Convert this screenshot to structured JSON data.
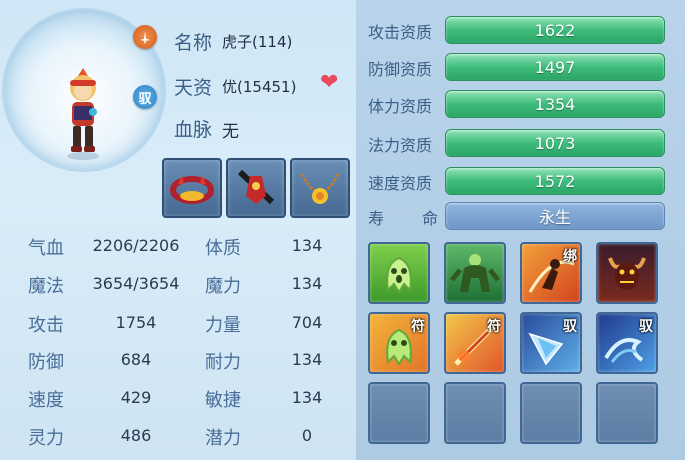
{
  "pet": {
    "name_label": "名称",
    "name_value": "虎子(114)",
    "aptitude_label": "天资",
    "aptitude_value": "优(15451)",
    "bloodline_label": "血脉",
    "bloodline_value": "无",
    "ride_badge": "驭"
  },
  "equipment": [
    {
      "name": "collar-equip"
    },
    {
      "name": "armor-equip"
    },
    {
      "name": "necklace-equip"
    }
  ],
  "stats": [
    {
      "label": "气血",
      "value": "2206/2206",
      "attr_label": "体质",
      "attr_value": "134"
    },
    {
      "label": "魔法",
      "value": "3654/3654",
      "attr_label": "魔力",
      "attr_value": "134"
    },
    {
      "label": "攻击",
      "value": "1754",
      "attr_label": "力量",
      "attr_value": "704"
    },
    {
      "label": "防御",
      "value": "684",
      "attr_label": "耐力",
      "attr_value": "134"
    },
    {
      "label": "速度",
      "value": "429",
      "attr_label": "敏捷",
      "attr_value": "134"
    },
    {
      "label": "灵力",
      "value": "486",
      "attr_label": "潜力",
      "attr_value": "0"
    }
  ],
  "aptitudes": [
    {
      "label": "攻击资质",
      "value": "1622"
    },
    {
      "label": "防御资质",
      "value": "1497"
    },
    {
      "label": "体力资质",
      "value": "1354"
    },
    {
      "label": "法力资质",
      "value": "1073"
    },
    {
      "label": "速度资质",
      "value": "1572"
    }
  ],
  "lifespan": {
    "label_a": "寿",
    "label_b": "命",
    "value": "永生"
  },
  "skills": [
    {
      "icon": "ghost-icon",
      "tag": ""
    },
    {
      "icon": "giant-icon",
      "tag": ""
    },
    {
      "icon": "bind-strike-icon",
      "tag": "绑"
    },
    {
      "icon": "demon-icon",
      "tag": ""
    },
    {
      "icon": "ghost-talisman-icon",
      "tag": "符"
    },
    {
      "icon": "fire-talisman-icon",
      "tag": "符"
    },
    {
      "icon": "ice-shard-icon",
      "tag": "驭"
    },
    {
      "icon": "ice-wave-icon",
      "tag": "驭"
    }
  ],
  "colors": {
    "accent_green": "#3fbc7c",
    "label_blue": "#3c5f86",
    "heart": "#ea4a5e"
  }
}
